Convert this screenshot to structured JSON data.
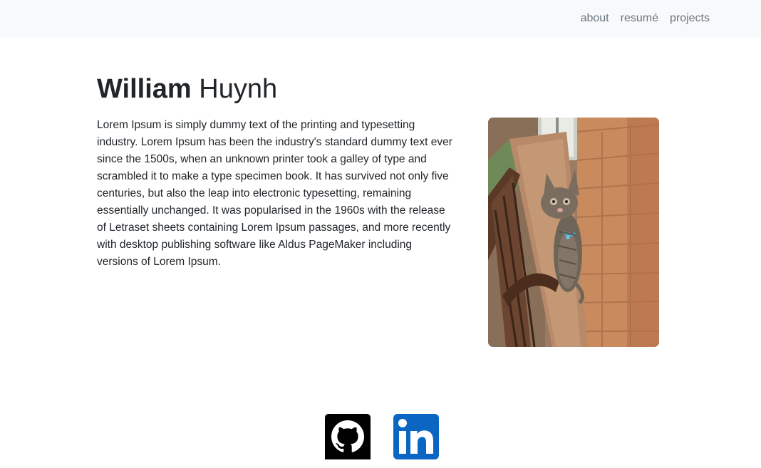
{
  "nav": {
    "links": [
      {
        "label": "about"
      },
      {
        "label": "resumé"
      },
      {
        "label": "projects"
      }
    ]
  },
  "hero": {
    "first_name": "William",
    "last_name": "Huynh",
    "bio": "Lorem Ipsum is simply dummy text of the printing and typesetting industry. Lorem Ipsum has been the industry's standard dummy text ever since the 1500s, when an unknown printer took a galley of type and scrambled it to make a type specimen book. It has survived not only five centuries, but also the leap into electronic typesetting, remaining essentially unchanged. It was popularised in the 1960s with the release of Letraset sheets containing Lorem Ipsum passages, and more recently with desktop publishing software like Aldus PageMaker including versions of Lorem Ipsum."
  },
  "social": {
    "github_icon": "github-icon",
    "linkedin_icon": "linkedin-icon",
    "colors": {
      "github": "#000000",
      "linkedin": "#0a66c2"
    }
  }
}
